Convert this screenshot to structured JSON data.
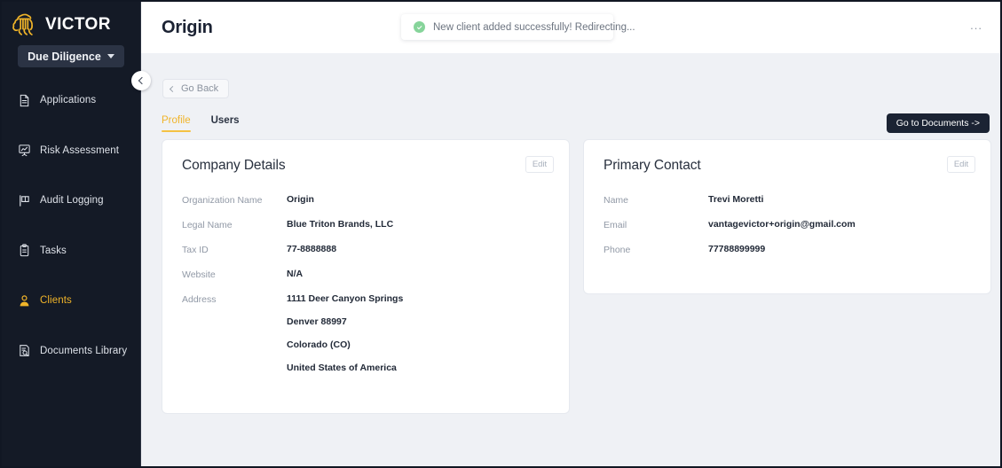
{
  "brand": {
    "name": "VICTOR",
    "logo_icon": "lion-logo-icon",
    "accent_color": "#f0b429"
  },
  "sidebar": {
    "workspace": {
      "label": "Due Diligence",
      "caret_icon": "chevron-down-icon"
    },
    "items": [
      {
        "label": "Applications",
        "icon": "document-icon",
        "active": false
      },
      {
        "label": "Risk Assessment",
        "icon": "presentation-chart-icon",
        "active": false
      },
      {
        "label": "Audit Logging",
        "icon": "flag-icon",
        "active": false
      },
      {
        "label": "Tasks",
        "icon": "clipboard-icon",
        "active": false
      },
      {
        "label": "Clients",
        "icon": "user-icon",
        "active": true
      },
      {
        "label": "Documents Library",
        "icon": "document-search-icon",
        "active": false
      }
    ],
    "collapse_button": {
      "icon": "chevron-left-icon"
    },
    "background_color": "#141a26"
  },
  "header": {
    "title": "Origin",
    "toast": {
      "icon": "check-circle-icon",
      "message": "New client added successfully! Redirecting...",
      "icon_color": "#86d49a"
    },
    "more_menu": {
      "label": "...",
      "icon": "ellipsis-icon"
    }
  },
  "content": {
    "go_back": {
      "label": "Go Back",
      "icon": "chevron-left-icon"
    },
    "tabs": [
      {
        "label": "Profile",
        "active": true
      },
      {
        "label": "Users",
        "active": false
      }
    ],
    "documents_button": {
      "label": "Go to Documents ->"
    },
    "cards": [
      {
        "title": "Company Details",
        "edit_label": "Edit",
        "fields": [
          {
            "label": "Organization Name",
            "value": "Origin"
          },
          {
            "label": "Legal Name",
            "value": "Blue Triton Brands, LLC"
          },
          {
            "label": "Tax ID",
            "value": "77-8888888"
          },
          {
            "label": "Website",
            "value": "N/A"
          }
        ],
        "address": {
          "label": "Address",
          "lines": [
            "1111 Deer Canyon Springs",
            "Denver 88997",
            "Colorado (CO)",
            "United States of America"
          ]
        }
      },
      {
        "title": "Primary Contact",
        "edit_label": "Edit",
        "fields": [
          {
            "label": "Name",
            "value": "Trevi Moretti"
          },
          {
            "label": "Email",
            "value": "vantagevictor+origin@gmail.com"
          },
          {
            "label": "Phone",
            "value": "77788899999"
          }
        ]
      }
    ]
  }
}
